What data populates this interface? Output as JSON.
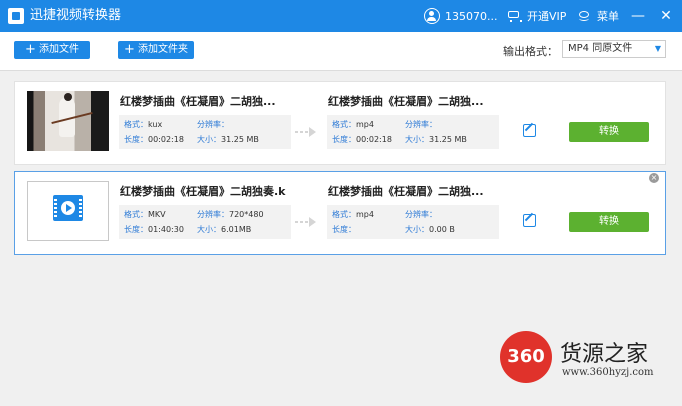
{
  "window": {
    "title": "迅捷视频转换器",
    "user": "135070...",
    "vip": "开通VIP",
    "menu": "菜单",
    "minimize": "—",
    "close": "✕"
  },
  "toolbar": {
    "add_file": "添加文件",
    "add_folder": "添加文件夹",
    "output_format_label": "输出格式：",
    "output_format_value": "MP4  同原文件"
  },
  "files": [
    {
      "source": {
        "name": "红楼梦插曲《枉凝眉》二胡独...",
        "format_label": "格式：",
        "format": "kux",
        "resolution_label": "分辨率：",
        "resolution": "",
        "duration_label": "长度：",
        "duration": "00:02:18",
        "size_label": "大小：",
        "size": "31.25 MB"
      },
      "target": {
        "name": "红楼梦插曲《枉凝眉》二胡独...",
        "format_label": "格式：",
        "format": "mp4",
        "resolution_label": "分辨率：",
        "resolution": "",
        "duration_label": "长度：",
        "duration": "00:02:18",
        "size_label": "大小：",
        "size": "31.25 MB"
      },
      "convert_label": "转换"
    },
    {
      "source": {
        "name": "红楼梦插曲《枉凝眉》二胡独奏.k",
        "format_label": "格式：",
        "format": "MKV",
        "resolution_label": "分辨率：",
        "resolution": "720*480",
        "duration_label": "长度：",
        "duration": "01:40:30",
        "size_label": "大小：",
        "size": "6.01MB"
      },
      "target": {
        "name": "红楼梦插曲《枉凝眉》二胡独...",
        "format_label": "格式：",
        "format": "mp4",
        "resolution_label": "分辨率：",
        "resolution": "",
        "duration_label": "长度：",
        "duration": "",
        "size_label": "大小：",
        "size": "0.00 B"
      },
      "convert_label": "转换",
      "remove": "×"
    }
  ],
  "watermark": {
    "logo": "360",
    "title": "货源之家",
    "url": "www.360hyzj.com"
  },
  "colors": {
    "titlebar": "#1e88e5",
    "convert_button": "#5cb130",
    "selected_border": "#5aa0e6"
  }
}
